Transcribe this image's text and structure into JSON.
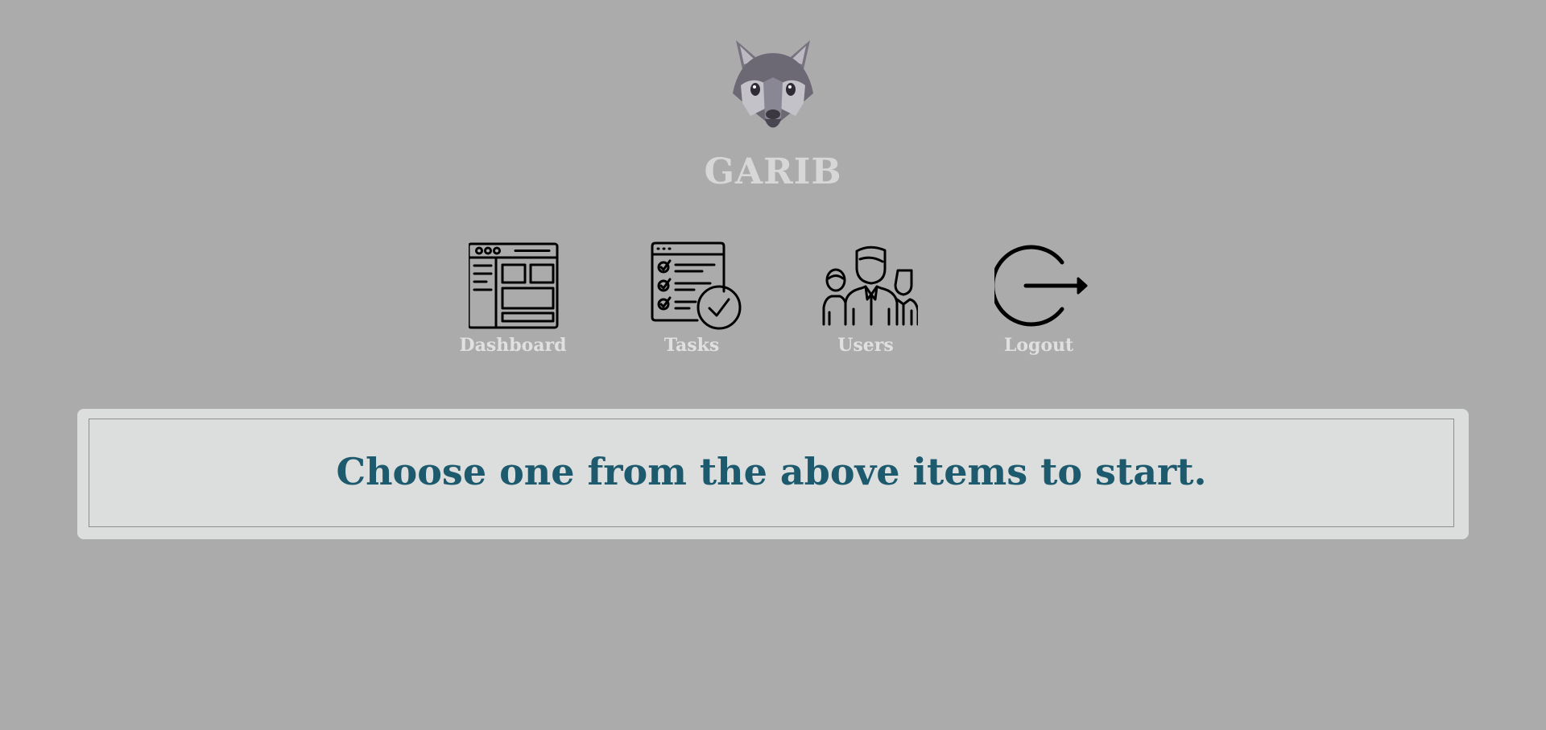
{
  "app": {
    "brand_name": "GARIB",
    "logo_icon": "wolf-head-icon"
  },
  "nav": {
    "items": [
      {
        "label": "Dashboard",
        "icon": "dashboard-icon"
      },
      {
        "label": "Tasks",
        "icon": "task-checklist-icon"
      },
      {
        "label": "Users",
        "icon": "users-group-icon"
      },
      {
        "label": "Logout",
        "icon": "logout-icon"
      }
    ]
  },
  "main": {
    "message": "Choose one from the above items to start."
  },
  "colors": {
    "background": "#ababab",
    "brand_text": "#d7d7d7",
    "nav_label": "#e0e0e0",
    "panel_background": "#dcdedd",
    "message_text": "#1d5a6e"
  }
}
